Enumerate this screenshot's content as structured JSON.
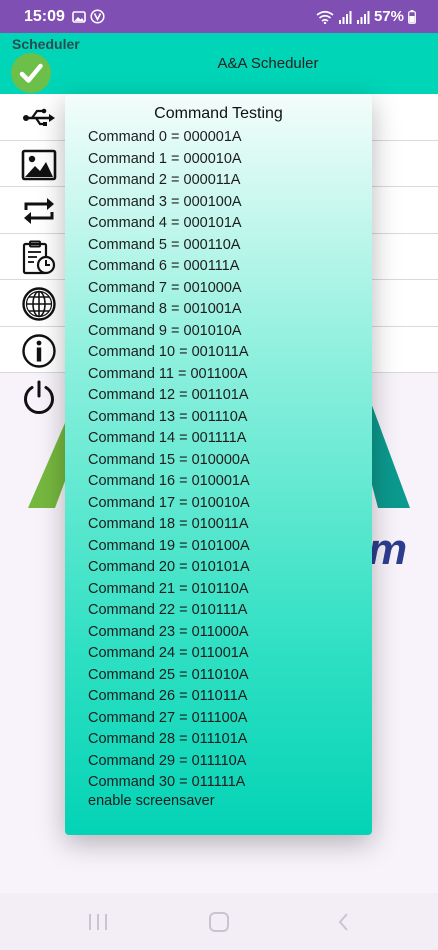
{
  "status_bar": {
    "time": "15:09",
    "battery": "57%",
    "icons": [
      "image-icon",
      "v-circle-icon",
      "wifi-icon",
      "signal-icon",
      "signal-icon",
      "battery-icon"
    ]
  },
  "app_bar": {
    "short_title": "Scheduler",
    "title": "A&A Scheduler",
    "logo_icon": "check-circle-icon"
  },
  "sidebar": {
    "items": [
      {
        "icon": "usb-icon"
      },
      {
        "icon": "image-icon"
      },
      {
        "icon": "repeat-icon"
      },
      {
        "icon": "schedule-icon"
      },
      {
        "icon": "globe-icon"
      },
      {
        "icon": "info-icon"
      },
      {
        "icon": "power-icon"
      }
    ]
  },
  "dialog": {
    "title": "Command Testing",
    "commands": [
      "Command 0 = 000001A",
      "Command 1 = 000010A",
      "Command 2 = 000011A",
      "Command 3 = 000100A",
      "Command 4 = 000101A",
      "Command 5 = 000110A",
      "Command 6 = 000111A",
      "Command 7 = 001000A",
      "Command 8 = 001001A",
      "Command 9 = 001010A",
      "Command 10 = 001011A",
      "Command 11 = 001100A",
      "Command 12 = 001101A",
      "Command 13 = 001110A",
      "Command 14 = 001111A",
      "Command 15 = 010000A",
      "Command 16 = 010001A",
      "Command 17 = 010010A",
      "Command 18 = 010011A",
      "Command 19 = 010100A",
      "Command 20 = 010101A",
      "Command 21 = 010110A",
      "Command 22 = 010111A",
      "Command 23 = 011000A",
      "Command 24 = 011001A",
      "Command 25 = 011010A",
      "Command 26 = 011011A",
      "Command 27 = 011100A",
      "Command 28 = 011101A",
      "Command 29 = 011110A",
      "Command 30 = 011111A"
    ],
    "footer": "enable screensaver"
  },
  "background": {
    "logo_fragment": "m"
  },
  "nav_bar": {
    "buttons": [
      "recents-icon",
      "home-icon",
      "back-icon"
    ]
  },
  "colors": {
    "status_bar": "#7f4fb4",
    "app_bar": "#00d5b7",
    "dialog_top": "#f4fdfb",
    "dialog_bottom": "#04d3b6",
    "logo_green": "#76b83f",
    "logo_teal": "#0c9a8e",
    "logo_blue": "#2e3e8f"
  }
}
